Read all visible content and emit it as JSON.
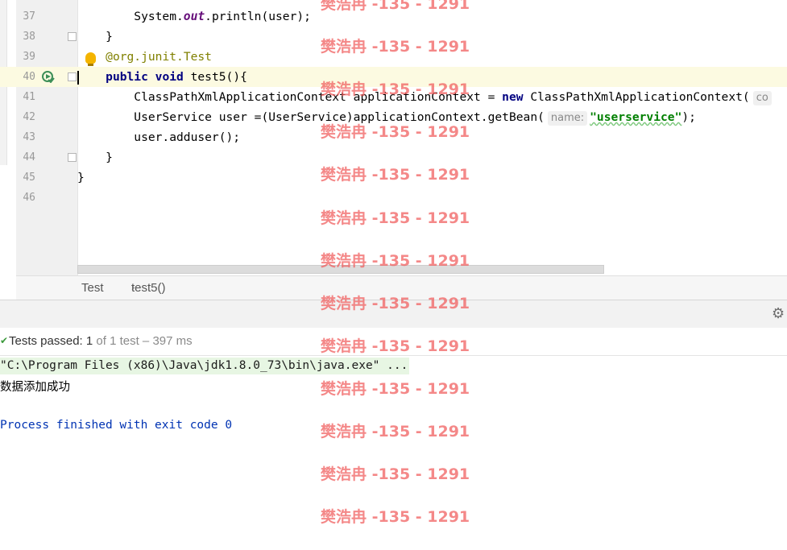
{
  "editor": {
    "lines": [
      {
        "num": "37",
        "segments": [
          {
            "t": "        System."
          },
          {
            "t": "out",
            "c": "fld"
          },
          {
            "t": ".println(user);"
          }
        ]
      },
      {
        "num": "38",
        "segments": [
          {
            "t": "    }"
          }
        ]
      },
      {
        "num": "39",
        "segments": [
          {
            "t": "    "
          },
          {
            "t": "@org.junit.",
            "c": "ann"
          },
          {
            "t": "Test",
            "c": "ann"
          }
        ]
      },
      {
        "num": "40",
        "segments": [
          {
            "t": "    "
          },
          {
            "t": "public void",
            "c": "kw"
          },
          {
            "t": " test5(){"
          }
        ]
      },
      {
        "num": "41",
        "segments": [
          {
            "t": "        ClassPathXmlApplicationContext applicationContext = "
          },
          {
            "t": "new",
            "c": "kw"
          },
          {
            "t": " ClassPathXmlApplicationContext("
          },
          {
            "t": "co",
            "c": "hint"
          }
        ]
      },
      {
        "num": "42",
        "segments": [
          {
            "t": "        UserService user =(UserService)applicationContext.getBean("
          },
          {
            "t": "name:",
            "c": "hint"
          },
          {
            "t": "\"userservice\"",
            "c": "str"
          },
          {
            "t": ");"
          }
        ]
      },
      {
        "num": "43",
        "segments": [
          {
            "t": "        user.adduser();"
          }
        ]
      },
      {
        "num": "44",
        "segments": [
          {
            "t": "    }"
          }
        ]
      },
      {
        "num": "45",
        "segments": [
          {
            "t": "}"
          }
        ]
      },
      {
        "num": "46",
        "segments": [
          {
            "t": ""
          }
        ]
      }
    ],
    "current_line": "40"
  },
  "breadcrumb": {
    "class_name": "Test",
    "method_name": "test5()"
  },
  "tests": {
    "label": "Tests passed: ",
    "passed": "1",
    "rest": " of 1 test – 397 ms"
  },
  "console": {
    "command": "\"C:\\Program Files (x86)\\Java\\jdk1.8.0_73\\bin\\java.exe\" ...",
    "output": "数据添加成功",
    "exit": "Process finished with exit code 0"
  },
  "watermark": {
    "text": "樊浩冉 -135 - 1291"
  },
  "colors": {
    "keyword": "#000080",
    "annotation": "#808000",
    "string": "#008000",
    "field": "#660e7a",
    "watermark": "#f05a5a"
  }
}
